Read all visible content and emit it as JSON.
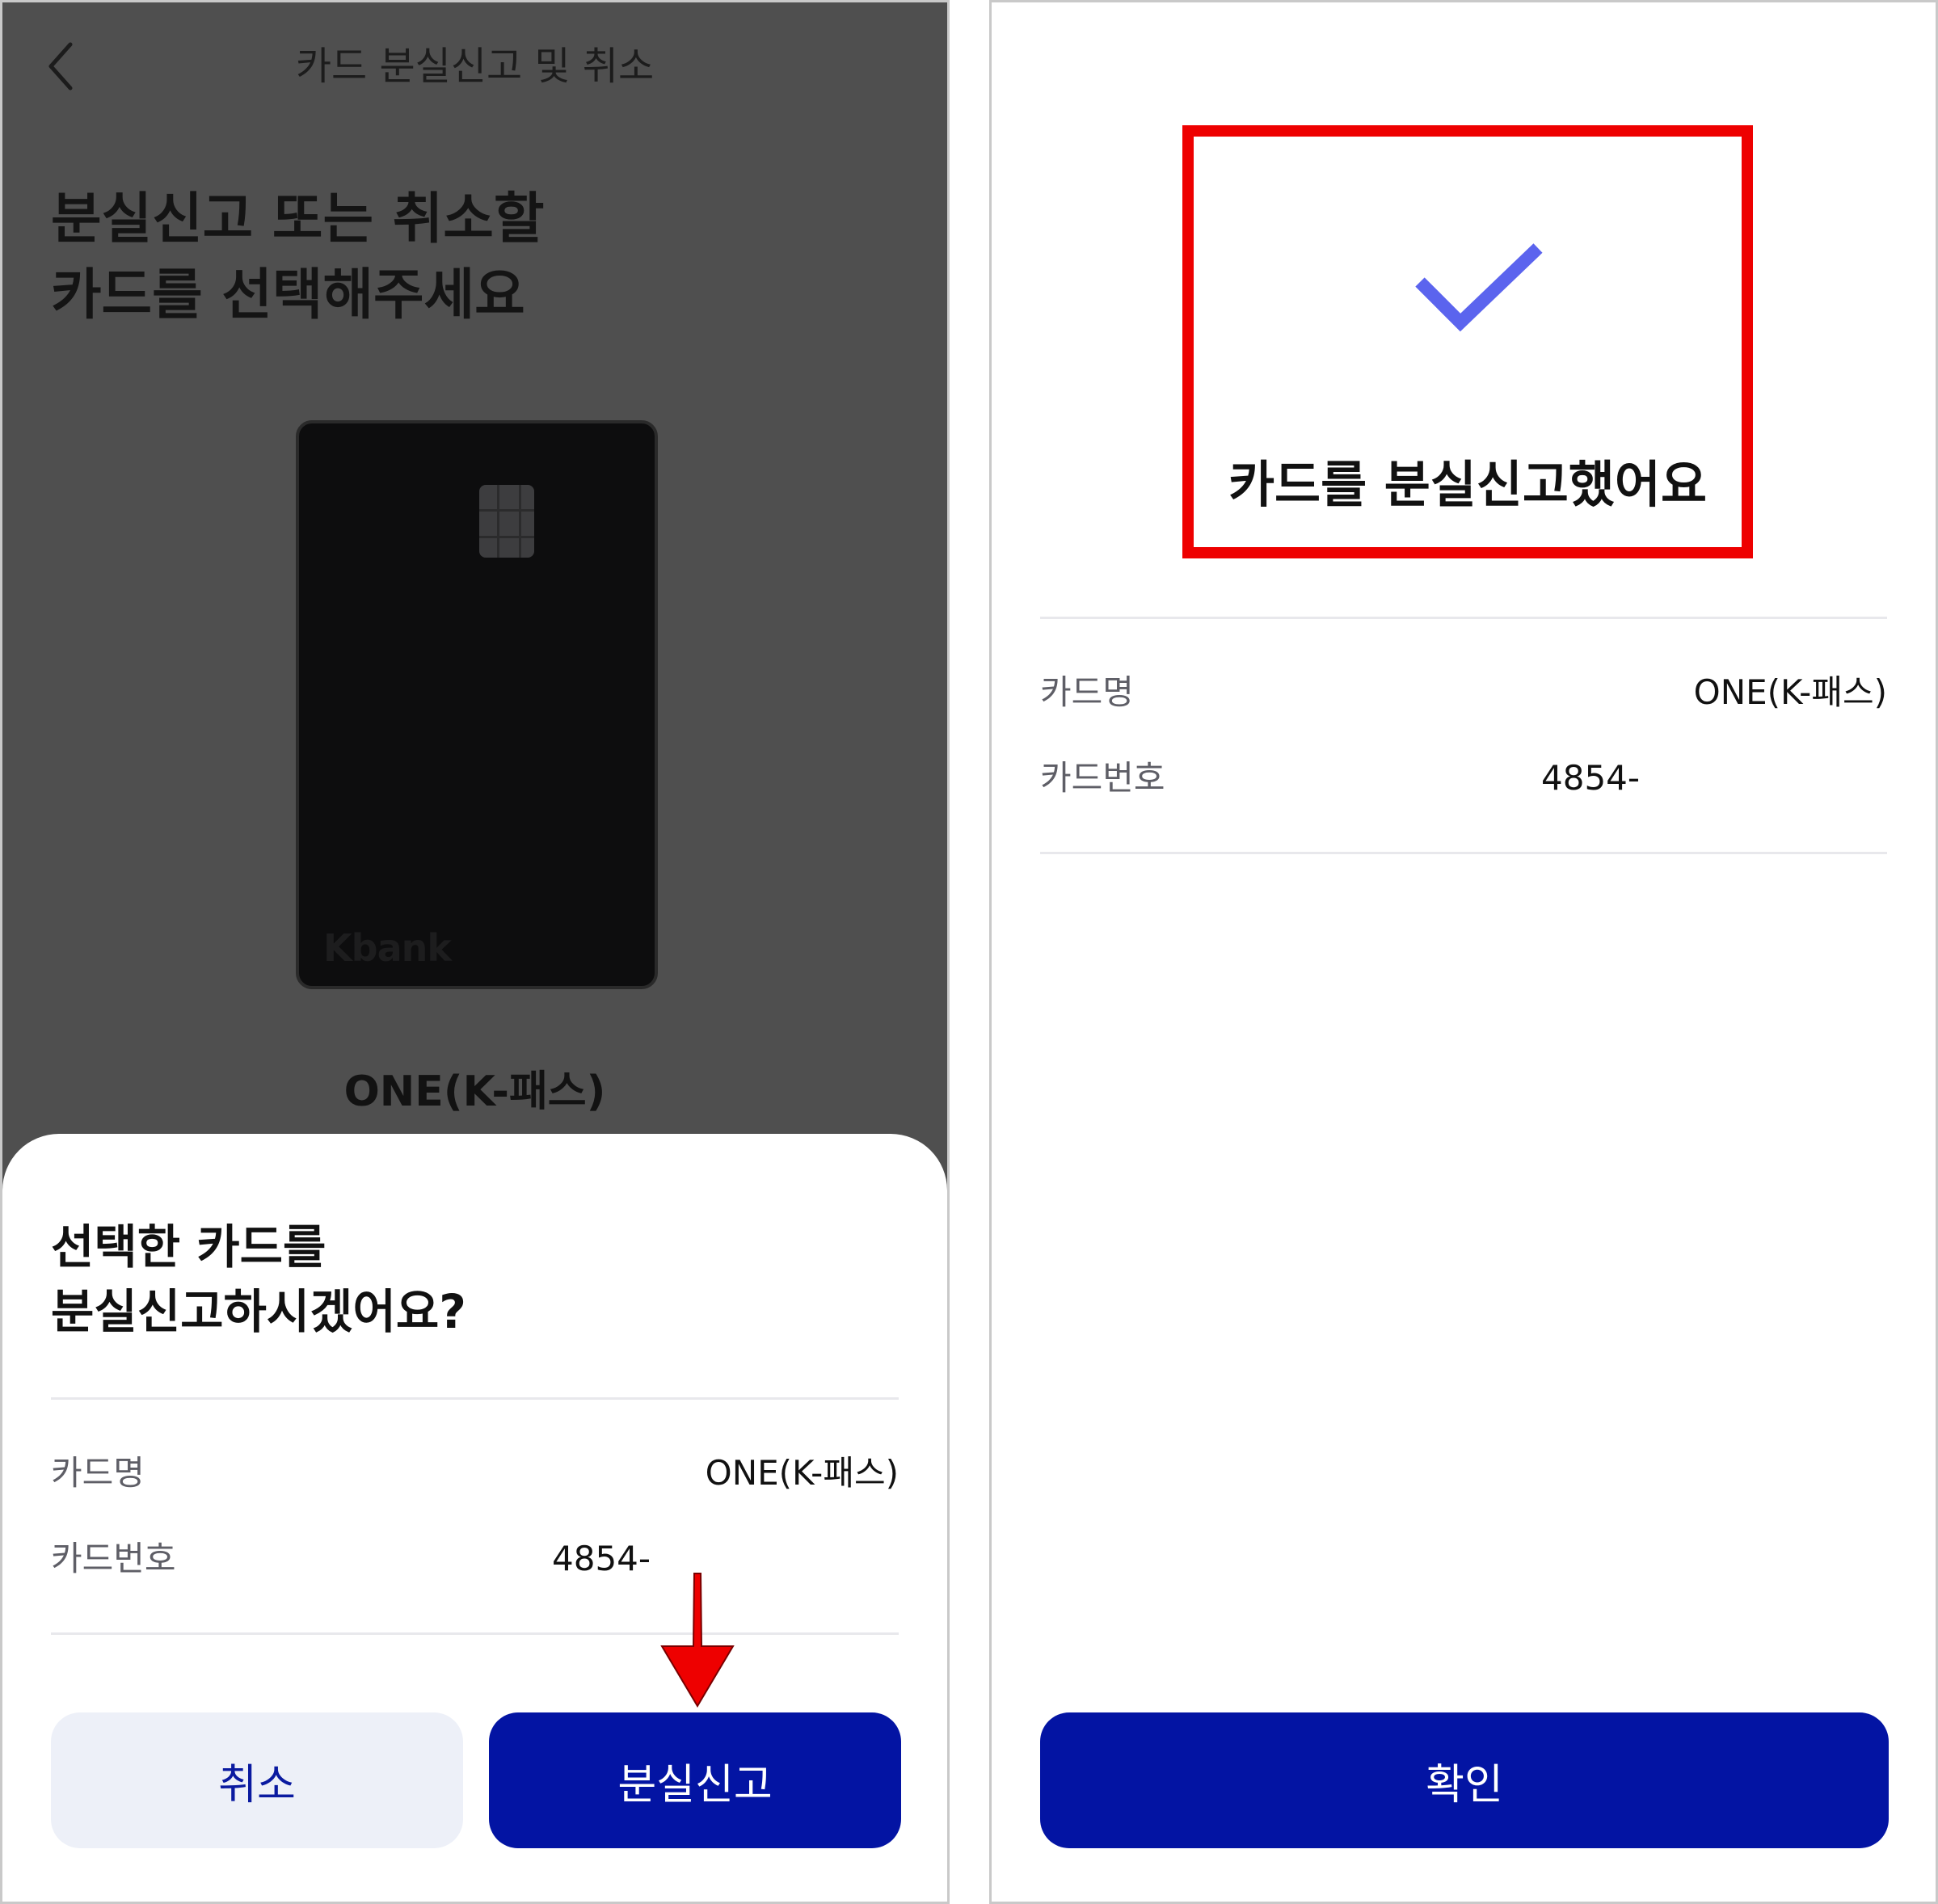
{
  "left": {
    "header": {
      "title": "카드 분실신고 및 취소"
    },
    "headline": {
      "line1": "분실신고 또는 취소할",
      "line2": "카드를 선택해주세요"
    },
    "card": {
      "brand": "Kbank",
      "name": "ONE(K-패스)"
    },
    "sheet": {
      "title_line1": "선택한 카드를",
      "title_line2": "분실신고하시겠어요?",
      "rows": [
        {
          "label": "카드명",
          "value": "ONE(K-패스)"
        },
        {
          "label": "카드번호",
          "value": "4854-"
        }
      ],
      "cancel_label": "취소",
      "report_label": "분실신고"
    }
  },
  "right": {
    "done_title": "카드를 분실신고했어요",
    "rows": [
      {
        "label": "카드명",
        "value": "ONE(K-패스)"
      },
      {
        "label": "카드번호",
        "value": "4854-"
      }
    ],
    "confirm_label": "확인"
  },
  "colors": {
    "primary": "#0314a3",
    "secondary_bg": "#edf0f8",
    "check": "#5b64ee",
    "highlight": "#ee0000",
    "annotation_arrow": "#ee0000",
    "overlay": "#4f4f4f"
  },
  "icons": {
    "back": "chevron-left-icon",
    "check": "checkmark-icon",
    "arrow": "down-arrow-icon"
  }
}
